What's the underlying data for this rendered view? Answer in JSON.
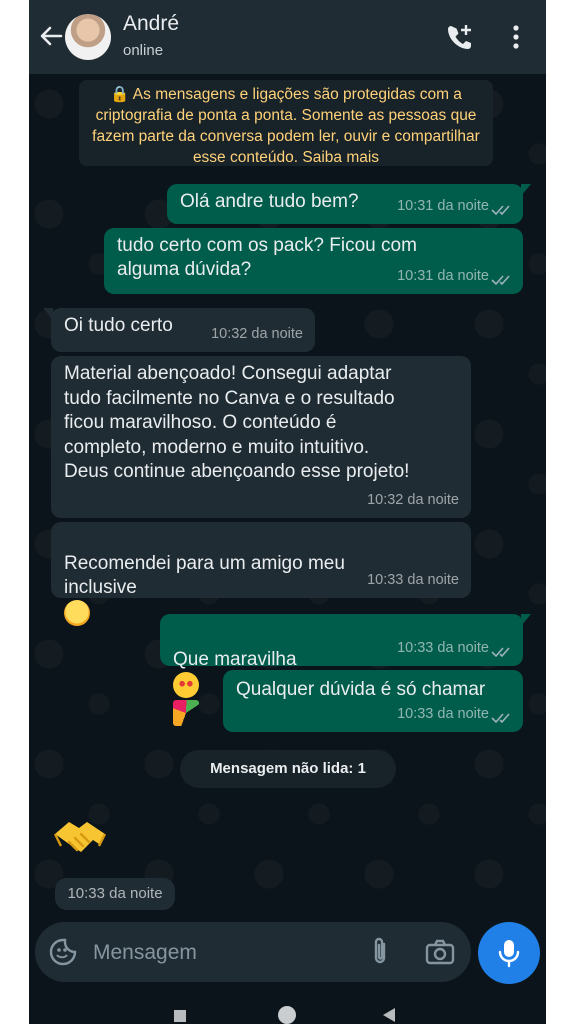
{
  "header": {
    "contact_name": "André",
    "status": "online"
  },
  "encryption_notice": "🔒 As mensagens e ligações são protegidas com a criptografia de ponta a ponta. Somente as pessoas que fazem parte da conversa podem ler, ouvir e compartilhar esse conteúdo. Saiba mais",
  "messages": [
    {
      "direction": "out",
      "text": "Olá andre tudo bem?",
      "time": "10:31 da noite",
      "status": "read"
    },
    {
      "direction": "out",
      "text": "tudo certo com os pack? Ficou com\nalguma dúvida?",
      "time": "10:31 da noite",
      "status": "read"
    },
    {
      "direction": "in",
      "text": "Oi tudo certo",
      "time": "10:32 da noite"
    },
    {
      "direction": "in",
      "text": "Material abençoado! Consegui adaptar\ntudo facilmente no Canva e o resultado\nficou maravilhoso. O conteúdo é\ncompleto, moderno e muito intuitivo.\nDeus continue abençoando esse projeto!",
      "time": "10:32 da noite"
    },
    {
      "direction": "in",
      "text": "Recomendei para um amigo meu\ninclusive",
      "time": "10:33 da noite",
      "emoji": "smiling-face-icon"
    },
    {
      "direction": "out",
      "text": "Que maravilha",
      "time": "10:33 da noite",
      "status": "read",
      "emoji": "heart-eyes-and-party-popper-icons"
    },
    {
      "direction": "out",
      "text": "Qualquer dúvida é só chamar",
      "time": "10:33 da noite",
      "status": "read"
    }
  ],
  "unread_label": "Mensagem não lida: 1",
  "handshake_message": {
    "emoji": "handshake-icon",
    "time": "10:33 da noite"
  },
  "input": {
    "placeholder": "Mensagem",
    "value": ""
  },
  "colors": {
    "outgoing_bubble": "#005c4b",
    "incoming_bubble": "#202c33",
    "header": "#1f2c34",
    "background": "#0b141a",
    "notice_text": "#ffd279",
    "mic_button": "#2180e8"
  }
}
